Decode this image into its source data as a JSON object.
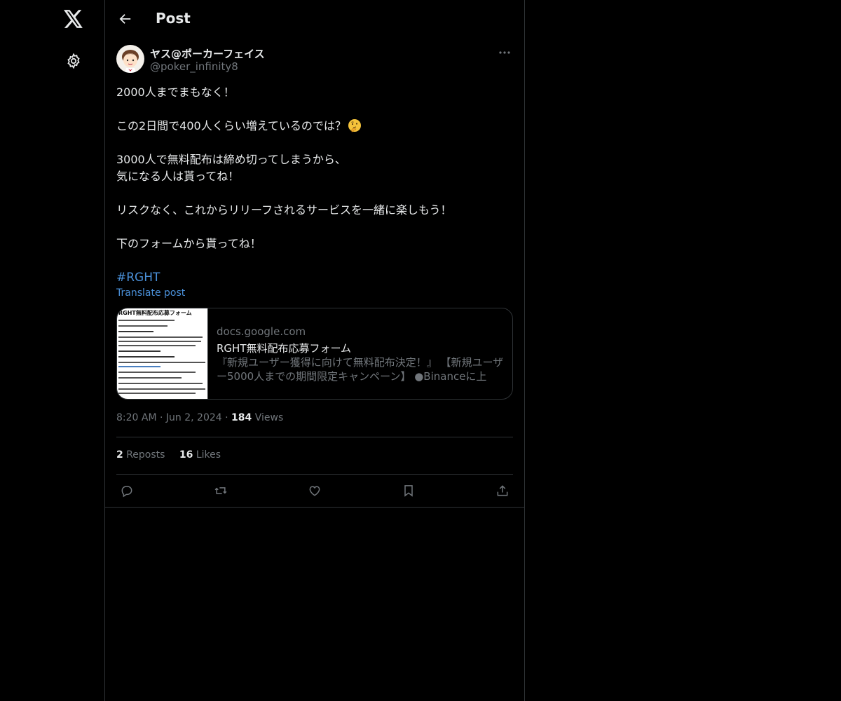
{
  "nav": {
    "logo_icon": "x-logo-icon",
    "settings_icon": "gear-icon"
  },
  "header": {
    "back_icon": "arrow-left-icon",
    "title": "Post"
  },
  "post": {
    "author_name": "ヤス@ポーカーフェイス",
    "author_handle": "@poker_infinity8",
    "avatar_icon": "avatar-cartoon",
    "more_icon": "more-dots-icon",
    "lines": [
      "2000人までまもなく！",
      "この2日間で400人くらい増えているのでは？",
      "3000人で無料配布は締め切ってしまうから、",
      "気になる人は貰ってね！",
      "リスクなく、これからリリーフされるサービスを一緒に楽しもう！",
      "下のフォームから貰ってね！"
    ],
    "emoji": "thinking-face-emoji",
    "hashtag": "#RGHT",
    "translate": "Translate post",
    "card": {
      "thumb_title": "RGHT無料配布応募フォーム",
      "domain": "docs.google.com",
      "title": "RGHT無料配布応募フォーム",
      "description": "『新規ユーザー獲得に向けて無料配布決定！』 【新規ユーザー5000人までの期間限定キャンペーン】 ●Binanceに上場..."
    },
    "time": "8:20 AM",
    "date": "Jun 2, 2024",
    "views_count": "184",
    "views_label": "Views",
    "reposts_count": "2",
    "reposts_label": "Reposts",
    "likes_count": "16",
    "likes_label": "Likes",
    "actions": [
      "reply-icon",
      "repost-icon",
      "like-icon",
      "bookmark-icon",
      "share-icon"
    ]
  },
  "colors": {
    "background": "#000000",
    "text": "#e7e9ea",
    "muted": "#71767b",
    "link": "#4a90d9",
    "border": "#2f3336"
  }
}
